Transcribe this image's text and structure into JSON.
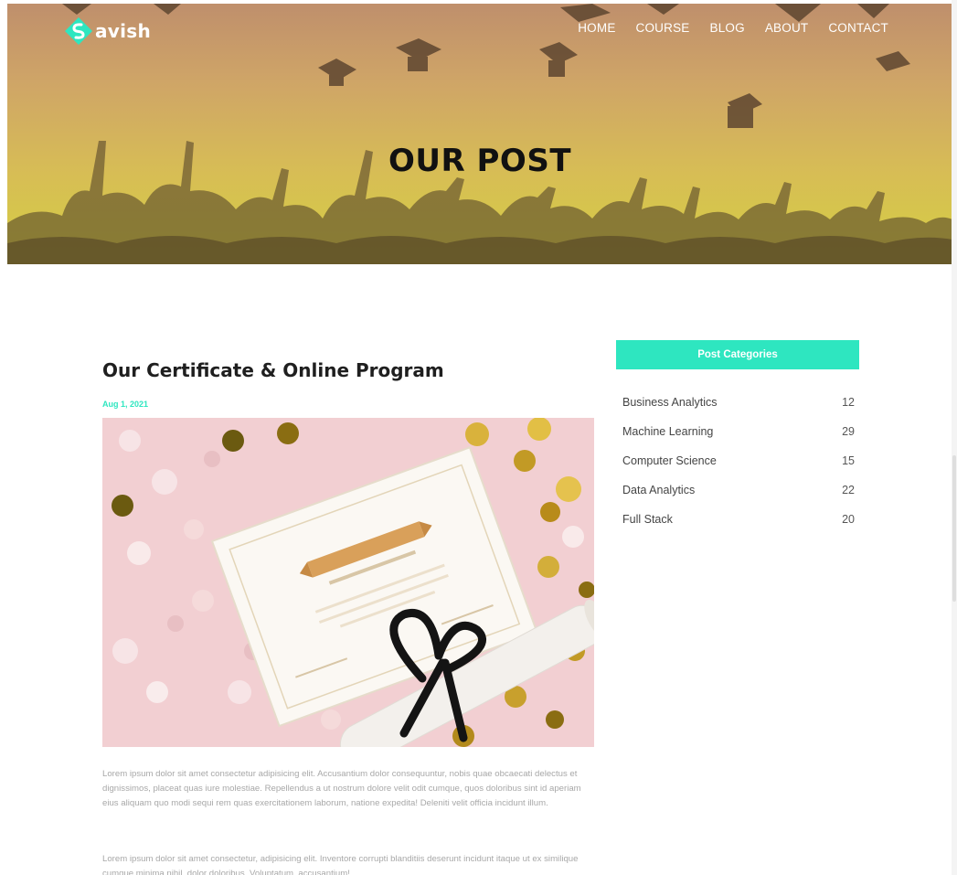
{
  "brand": {
    "name": "avish",
    "accent": "#2ee6c0"
  },
  "nav": {
    "items": [
      "HOME",
      "COURSE",
      "BLOG",
      "ABOUT",
      "CONTACT"
    ]
  },
  "hero": {
    "title": "OUR POST"
  },
  "post": {
    "title": "Our Certificate & Online Program",
    "date": "Aug 1, 2021",
    "image_alt": "certificate-with-ribbon-and-confetti",
    "paragraphs": [
      "Lorem ipsum dolor sit amet consectetur adipisicing elit. Accusantium dolor consequuntur, nobis quae obcaecati delectus et dignissimos, placeat quas iure molestiae. Repellendus a ut nostrum dolore velit odit cumque, quos doloribus sint id aperiam eius aliquam quo modi sequi rem quas exercitationem laborum, natione expedita! Deleniti velit officia incidunt illum.",
      "Lorem ipsum dolor sit amet consectetur, adipisicing elit. Inventore corrupti blanditiis deserunt incidunt itaque ut ex similique cumque minima nihil, dolor doloribus. Voluptatum, accusantium!"
    ]
  },
  "sidebar": {
    "heading": "Post Categories",
    "categories": [
      {
        "name": "Business Analytics",
        "count": "12"
      },
      {
        "name": "Machine Learning",
        "count": "29"
      },
      {
        "name": "Computer Science",
        "count": "15"
      },
      {
        "name": "Data Analytics",
        "count": "22"
      },
      {
        "name": "Full Stack",
        "count": "20"
      }
    ]
  }
}
